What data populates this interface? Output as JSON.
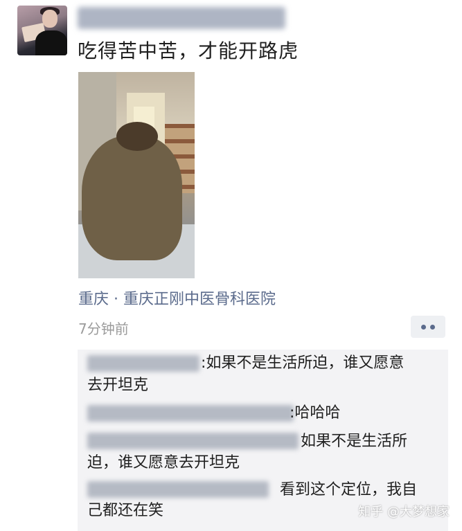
{
  "post": {
    "text": "吃得苦中苦，才能开路虎",
    "location": "重庆 · 重庆正刚中医骨科医院",
    "timestamp": "7分钟前"
  },
  "comments": [
    {
      "line1": ":如果不是生活所迫，谁又愿意",
      "line2": "去开坦克"
    },
    {
      "line1": ":哈哈哈"
    },
    {
      "line1": "如果不是生活所",
      "line2": "迫，谁又愿意去开坦克"
    },
    {
      "line1": "看到这个定位，我自",
      "line2": "己都还在笑"
    }
  ],
  "watermark": "知乎 @大梦想家",
  "icons": {
    "more": "more-dots-icon"
  }
}
